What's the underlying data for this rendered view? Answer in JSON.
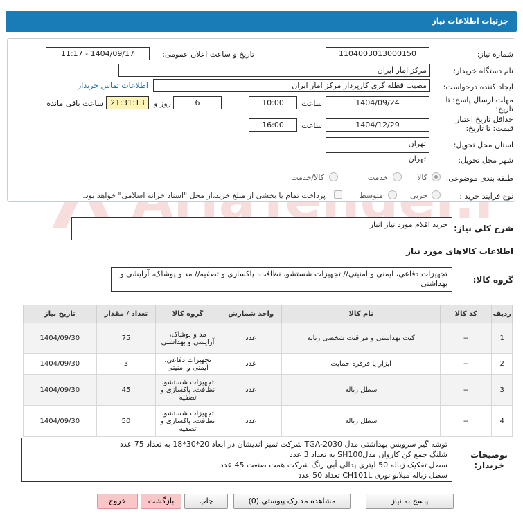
{
  "header": {
    "title": "جزئیات اطلاعات نیاز"
  },
  "form": {
    "need_number_label": "شماره نیاز:",
    "need_number": "1104003013000150",
    "announce_label": "تاریخ و ساعت اعلان عمومی:",
    "announce_value": "1404/09/17 - 11:17",
    "buyer_org_label": "نام دستگاه خریدار:",
    "buyer_org": "مرکز امار ایران",
    "creator_label": "ایجاد کننده درخواست:",
    "creator": "مصیب قطله گری کارپرداز مرکز امار ایران",
    "contact_link": "اطلاعات تماس خریدار",
    "deadline_label": "مهلت ارسال پاسخ: تا تاریخ:",
    "deadline_date": "1404/09/24",
    "time_label": "ساعت",
    "deadline_time": "10:00",
    "days_value": "6",
    "days_label": "روز و",
    "remaining_time": "21:31:13",
    "remaining_label": "ساعت باقی مانده",
    "min_price_label": "حداقل تاریخ اعتبار قیمت: تا تاریخ:",
    "min_price_date": "1404/12/29",
    "min_price_time": "16:00",
    "province_label": "استان محل تحویل:",
    "province": "تهران",
    "city_label": "شهر محل تحویل:",
    "city": "تهران",
    "category_label": "طبقه بندی موضوعی:",
    "category_options": [
      "کالا",
      "خدمت",
      "کالا/خدمت"
    ],
    "process_label": "نوع فرآیند خرید :",
    "process_options": [
      "جزیی",
      "متوسط"
    ],
    "payment_note": "پرداخت تمام یا بخشی از مبلغ خرید،از محل \"اسناد خزانه اسلامی\" خواهد بود."
  },
  "summary": {
    "label": "شرح کلی نیاز:",
    "value": "خرید اقلام مورد نیاز انبار"
  },
  "goods_section": {
    "title": "اطلاعات کالاهای مورد نیاز",
    "group_label": "گروه کالا:",
    "group_value": "تجهیزات دفاعی، ایمنی و امنیتی// تجهیزات شستشو، نظافت، پاکسازی و تصفیه// مد و پوشاک، آرایشی و بهداشتی"
  },
  "table": {
    "headers": [
      "ردیف",
      "کد کالا",
      "نام کالا",
      "واحد شمارش",
      "گروه کالا",
      "تعداد / مقدار",
      "تاریخ نیاز"
    ],
    "rows": [
      [
        "1",
        "--",
        "کیت بهداشتی و مراقبت شخصی زنانه",
        "عدد",
        "مد و پوشاک، آرایشی و بهداشتی",
        "75",
        "1404/09/30"
      ],
      [
        "2",
        "--",
        "ابزار یا قرقره حمایت",
        "عدد",
        "تجهیزات دفاعی، ایمنی و امنیتی",
        "3",
        "1404/09/30"
      ],
      [
        "3",
        "--",
        "سطل زباله",
        "عدد",
        "تجهیزات شستشو، نظافت، پاکسازی و تصفیه",
        "45",
        "1404/09/30"
      ],
      [
        "4",
        "--",
        "سطل زباله",
        "عدد",
        "تجهیزات شستشو، نظافت، پاکسازی و تصفیه",
        "50",
        "1404/09/30"
      ]
    ]
  },
  "buyer_notes": {
    "label": "توضیحات خریدار:",
    "lines": [
      "توشه گیر سرویس بهداشتی مدل TGA-2030 شرکت تمیز اندیشان در ابعاد 20*30*18 به تعداد 75 عدد",
      "شلنگ جمع کن کاروان مدلSH100 به تعداد 3 عدد",
      "سطل تفکیک زباله 50 لیتری پدالی آبی رنگ شرکت همت صنعت 45 عدد",
      "سطل زباله میلانو نوری CH101L تعداد 50 عدد"
    ]
  },
  "buttons": {
    "reply": "پاسخ به نیاز",
    "attachments": "مشاهده مدارک پیوستی (0)",
    "print": "چاپ",
    "back": "بازگشت",
    "exit": "خروج"
  },
  "watermark": {
    "text": "AriaTender.net"
  },
  "colors": {
    "title_bar": "#1a7cb7",
    "link": "#1a6fb0",
    "highlight": "#fdf5b8",
    "exit_button": "#f9c7c7"
  }
}
